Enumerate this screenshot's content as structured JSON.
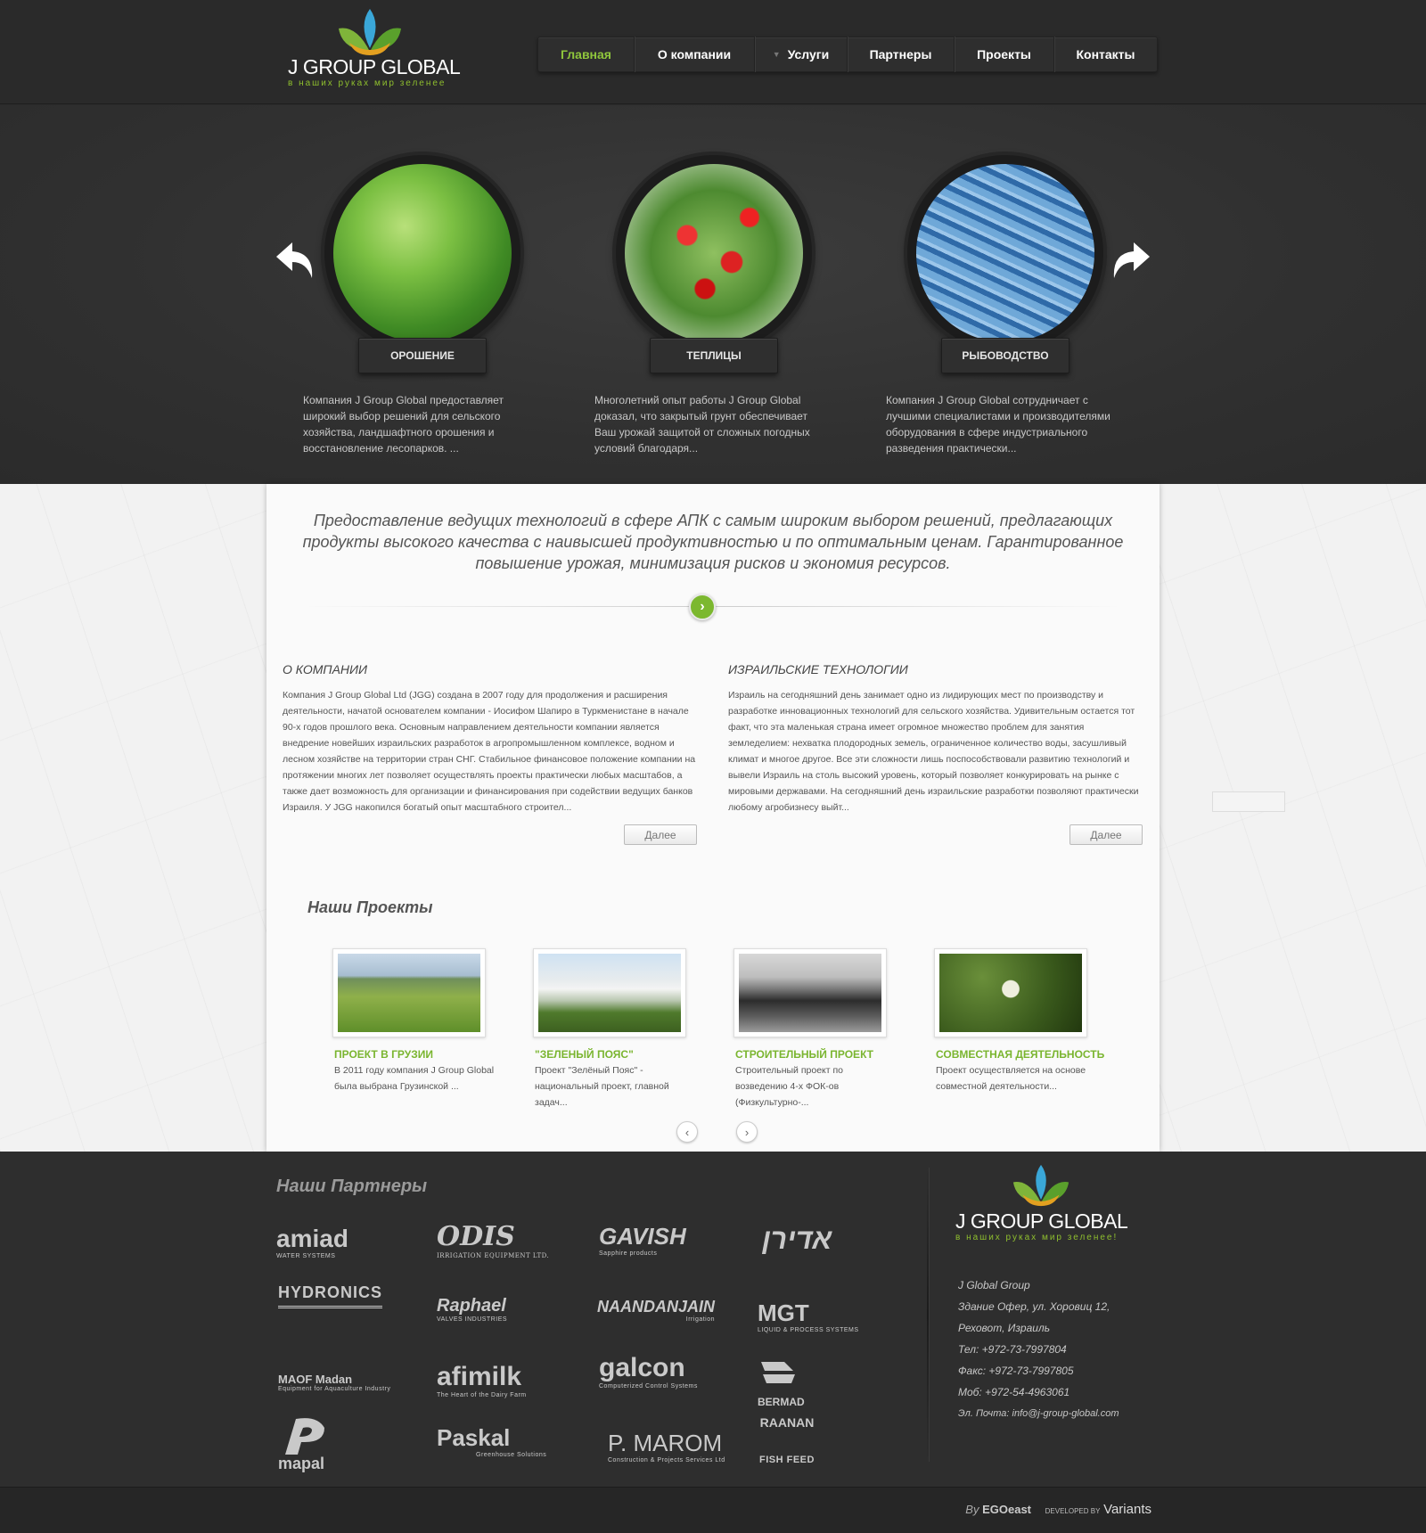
{
  "header": {
    "logo_name": "J GROUP GLOBAL",
    "logo_slogan": "в наших руках мир зеленее",
    "nav": [
      {
        "label": "Главная",
        "active": true
      },
      {
        "label": "О компании"
      },
      {
        "label": "Услуги",
        "has_dropdown": true
      },
      {
        "label": "Партнеры"
      },
      {
        "label": "Проекты"
      },
      {
        "label": "Контакты"
      }
    ]
  },
  "hero": {
    "features": [
      {
        "label": "ОРОШЕНИЕ",
        "text": "Компания J Group Global предоставляет широкий выбор решений для сельского хозяйства, ландшафтного орошения и восстановление лесопарков. ..."
      },
      {
        "label": "ТЕПЛИЦЫ",
        "text": "Многолетний опыт работы J Group Global доказал, что закрытый грунт обеспечивает Ваш урожай защитой от сложных погодных условий благодаря..."
      },
      {
        "label": "РЫБОВОДСТВО",
        "text": "Компания J Group Global сотрудничает с лучшими специалистами и производителями оборудования в сфере индустриального разведения практически..."
      }
    ]
  },
  "main": {
    "slogan": "Предоставление ведущих технологий в сфере АПК с самым широким выбором решений, предлагающих продукты высокого качества с наивысшей продуктивностью и по оптимальным ценам. Гарантированное повышение урожая, минимизация рисков и экономия ресурсов.",
    "go_symbol": "›",
    "about": {
      "title": "О КОМПАНИИ",
      "text": "Компания J Group Global Ltd (JGG) создана в 2007 году для продолжения и расширения деятельности, начатой основателем компании - Иосифом Шапиро в Туркменистане в начале 90-х годов прошлого века. Основным направлением деятельности компании является внедрение новейших израильских разработок в агропромышленном комплексе, водном и лесном хозяйстве на территории стран СНГ. Стабильное финансовое положение компании на протяжении многих лет позволяет осуществлять проекты практически любых масштабов, а также дает возможность для организации и финансирования при содействии ведущих банков Израиля. У JGG накопился богатый опыт масштабного строител...",
      "more": "Далее"
    },
    "tech": {
      "title": "ИЗРАИЛЬСКИЕ ТЕХНОЛОГИИ",
      "text": "Израиль на сегодняшний день занимает одно из лидирующих мест по производству и разработке инновационных технологий для сельского хозяйства. Удивительным остается тот факт, что эта маленькая страна имеет огромное множество проблем для занятия земледелием: нехватка плодородных земель, ограниченное количество воды, засушливый климат и многое другое. Все эти сложности лишь поспособствовали развитию технологий и вывели Израиль на столь высокий уровень, который позволяет конкурировать на рынке с мировыми державами. На сегодняшний день израильские разработки позволяют практически любому агробизнесу выйт...",
      "more": "Далее"
    },
    "projects_title": "Наши Проекты",
    "projects": [
      {
        "title": "ПРОЕКТ В ГРУЗИИ",
        "text": "В 2011 году компания J Group Global была выбрана Грузинской ..."
      },
      {
        "title": "\"ЗЕЛЕНЫЙ ПОЯС\"",
        "text": "Проект \"Зелёный Пояс\" - национальный проект, главной задач..."
      },
      {
        "title": "СТРОИТЕЛЬНЫЙ ПРОЕКТ",
        "text": "Строительный проект по возведению 4-х ФОК-ов (Физкультурно-..."
      },
      {
        "title": "СОВМЕСТНАЯ ДЕЯТЕЛЬНОСТЬ",
        "text": "Проект осуществляется на основе совместной деятельности..."
      }
    ],
    "pager_prev": "‹",
    "pager_next": "›"
  },
  "footer": {
    "partners_title": "Наши Партнеры",
    "partners": [
      {
        "name": "amiad",
        "sub": "WATER SYSTEMS"
      },
      {
        "name": "ODIS",
        "sub": "IRRIGATION EQUIPMENT LTD."
      },
      {
        "name": "GAVISH",
        "sub": "Sapphire products"
      },
      {
        "name": "אדירן",
        "sub": ""
      },
      {
        "name": "HYDRONICS",
        "sub": ""
      },
      {
        "name": "Raphael",
        "sub": "VALVES INDUSTRIES"
      },
      {
        "name": "NAANDANJAIN",
        "sub": "Irrigation"
      },
      {
        "name": "MGT",
        "sub": "LIQUID & PROCESS SYSTEMS"
      },
      {
        "name": "MAOF Madan",
        "sub": "Equipment for Aquaculture Industry"
      },
      {
        "name": "afimilk",
        "sub": "The Heart of the Dairy Farm"
      },
      {
        "name": "galcon",
        "sub": "Computerized Control Systems"
      },
      {
        "name": "BERMAD",
        "sub": ""
      },
      {
        "name": "mapal",
        "sub": ""
      },
      {
        "name": "Paskal",
        "sub": "Greenhouse Solutions"
      },
      {
        "name": "P. MAROM",
        "sub": "Construction & Projects Services Ltd"
      },
      {
        "name": "RAANAN",
        "sub": "FISH FEED"
      }
    ],
    "logo_name": "J GROUP GLOBAL",
    "logo_slogan": "в наших руках мир зеленее!",
    "contacts": [
      "J Global Group",
      "Здание Офер, ул. Хоровиц 12,",
      "Реховот, Израиль",
      "Тел: +972-73-7997804",
      "Факс: +972-73-7997805",
      "Моб: +972-54-4963061",
      "Эл. Почта: info@j-group-global.com"
    ],
    "credits_by": "By",
    "credits_ego": "EGOeast",
    "credits_dev": "DEVELOPED BY",
    "credits_variants": "Variants"
  },
  "colors": {
    "accent_green": "#7ab52f",
    "nav_active": "#8fc63c"
  }
}
